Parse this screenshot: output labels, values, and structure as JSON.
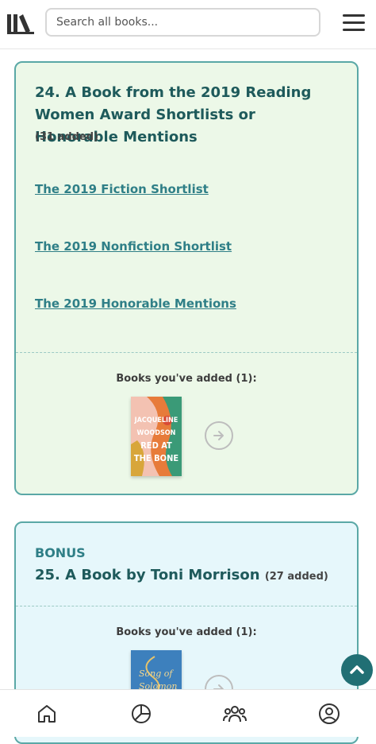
{
  "header": {
    "logo_icon": "library-books-icon",
    "search_placeholder": "Search all books...",
    "menu_icon": "hamburger-menu-icon"
  },
  "challenges": [
    {
      "title": "24. A Book from the 2019 Reading Women Award Shortlists or Honorable Mentions",
      "count": "(31 added)",
      "links": [
        "The 2019 Fiction Shortlist",
        "The 2019 Nonfiction Shortlist",
        "The 2019 Honorable Mentions"
      ],
      "added_label": "Books you've added (1):",
      "cover_lines": [
        "JACQUELINE",
        "WOODSON",
        "RED AT",
        "THE BONE"
      ],
      "background": "#ecf8e8"
    },
    {
      "bonus_label": "BONUS",
      "title": "25. A Book by Toni Morrison",
      "count": "(27 added)",
      "added_label": "Books you've added (1):",
      "cover_lines": [
        "Song of",
        "Solomon"
      ],
      "background": "#e6f7fb"
    }
  ],
  "bottom_nav": {
    "items": [
      "home-icon",
      "stats-pie-icon",
      "community-icon",
      "profile-icon"
    ]
  },
  "colors": {
    "accent": "#2f7f87",
    "title": "#1e5a5b",
    "border": "#5aa8a6",
    "back_to_top": "#216f74"
  }
}
